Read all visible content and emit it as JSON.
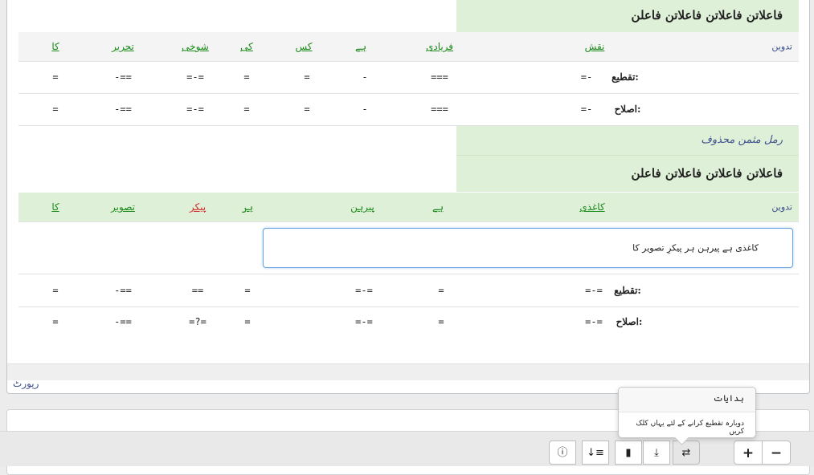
{
  "section1": {
    "meter": "فاعلاتن فاعلاتن فاعلاتن فاعلن",
    "tadween_label": "تدوین",
    "words": [
      "نقش",
      "فریادی",
      "ہے",
      "کس",
      "کی",
      "شوخی",
      "تحریر",
      "کا"
    ],
    "taqti_label": "تقطیع:",
    "taqti": [
      "=-",
      "===",
      "-",
      "=",
      "=",
      "=-=",
      "-==",
      "="
    ],
    "islah_label": "اصلاح:",
    "islah": [
      "=-",
      "===",
      "-",
      "=",
      "=",
      "=-=",
      "-==",
      "="
    ]
  },
  "section2": {
    "meter_name": "رمل مثمن محذوف",
    "meter": "فاعلاتن فاعلاتن فاعلاتن فاعلن",
    "tadween_label": "تدوین",
    "words": [
      "کاغذی",
      "ہے",
      "پیرہن",
      "ہر",
      "پیکر",
      "تصویر",
      "کا"
    ],
    "red_word_index": 4,
    "input_text": "کاغذی ہے پیرہن ہر پیکرِ تصویر کا",
    "taqti_label": "تقطیع:",
    "taqti": [
      "=-=",
      "=",
      "=-=",
      "=",
      "==",
      "-==",
      "="
    ],
    "islah_label": "اصلاح:",
    "islah": [
      "=-=",
      "=",
      "=-=",
      "=",
      "=?=",
      "-==",
      "="
    ]
  },
  "report_label": "رپورٹ",
  "popover": {
    "title": "ہدایات",
    "body": "دوبارہ تقطیع کرانے کے لئے یہاں کلک کریں"
  },
  "toolbar": {
    "info_icon": "ⓘ",
    "sort_icon": "↓≡",
    "book_icon": "▮",
    "save_icon": "⤓",
    "swap_icon": "⇄",
    "plus": "+",
    "minus": "−"
  }
}
